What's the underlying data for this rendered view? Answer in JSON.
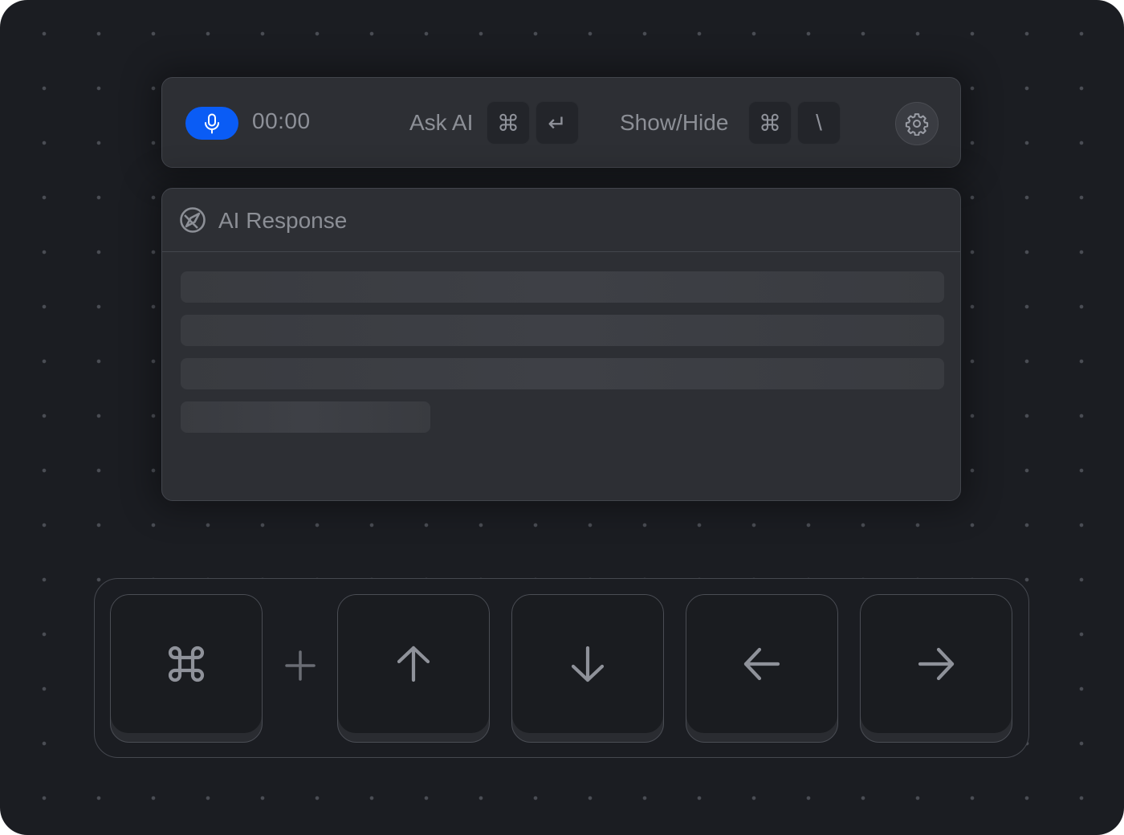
{
  "toolbar": {
    "mic_icon": "microphone-icon",
    "timer": "00:00",
    "ask_ai_label": "Ask AI",
    "ask_ai_keys": [
      "⌘",
      "↵"
    ],
    "show_hide_label": "Show/Hide",
    "show_hide_keys": [
      "⌘",
      "\\"
    ],
    "settings_icon": "gear-icon",
    "accent_color": "#0a5cf5"
  },
  "panel": {
    "icon": "compass-icon",
    "title": "AI Response"
  },
  "shortcut": {
    "modifier_key": "⌘",
    "joiner": "plus",
    "keys": [
      "arrow-up",
      "arrow-down",
      "arrow-left",
      "arrow-right"
    ]
  }
}
